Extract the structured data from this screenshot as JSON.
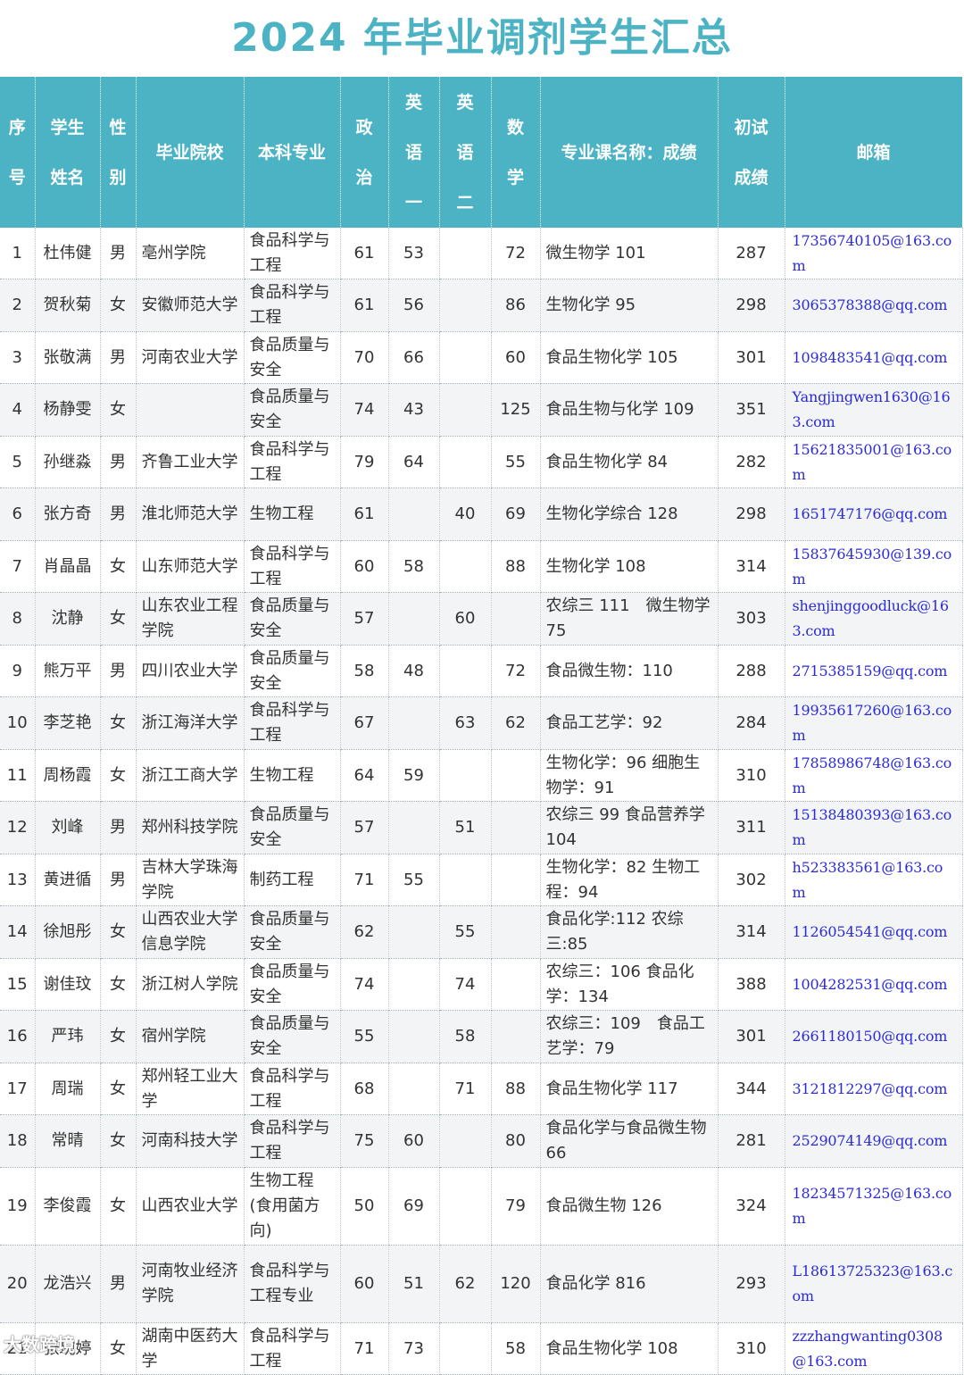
{
  "title": "2024 年毕业调剂学生汇总",
  "headers": [
    "序\n号",
    "学生\n姓名",
    "性\n别",
    "毕业院校",
    "本科专业",
    "政\n治",
    "英\n语\n一",
    "英\n语\n二",
    "数\n学",
    "专业课名称：成绩",
    "初试\n成绩",
    "邮箱"
  ],
  "rows": [
    {
      "no": "1",
      "name": "杜伟健",
      "sex": "男",
      "school": "亳州学院",
      "major": "食品科学与工程",
      "pol": "61",
      "eng1": "53",
      "eng2": "",
      "math": "72",
      "course": "微生物学 101",
      "total": "287",
      "email": "17356740105@163.com"
    },
    {
      "no": "2",
      "name": "贺秋菊",
      "sex": "女",
      "school": "安徽师范大学",
      "major": "食品科学与工程",
      "pol": "61",
      "eng1": "56",
      "eng2": "",
      "math": "86",
      "course": "生物化学 95",
      "total": "298",
      "email": "3065378388@qq.com"
    },
    {
      "no": "3",
      "name": "张敬满",
      "sex": "男",
      "school": "河南农业大学",
      "major": "食品质量与安全",
      "pol": "70",
      "eng1": "66",
      "eng2": "",
      "math": "60",
      "course": "食品生物化学 105",
      "total": "301",
      "email": "1098483541@qq.com"
    },
    {
      "no": "4",
      "name": "杨静雯",
      "sex": "女",
      "school": "",
      "major": "食品质量与安全",
      "pol": "74",
      "eng1": "43",
      "eng2": "",
      "math": "125",
      "course": "食品生物与化学 109",
      "total": "351",
      "email": "Yangjingwen1630@163.com"
    },
    {
      "no": "5",
      "name": "孙继淼",
      "sex": "男",
      "school": "齐鲁工业大学",
      "major": "食品科学与工程",
      "pol": "79",
      "eng1": "64",
      "eng2": "",
      "math": "55",
      "course": "食品生物化学 84",
      "total": "282",
      "email": "15621835001@163.com"
    },
    {
      "no": "6",
      "name": "张方奇",
      "sex": "男",
      "school": "淮北师范大学",
      "major": "生物工程",
      "pol": "61",
      "eng1": "",
      "eng2": "40",
      "math": "69",
      "course": "生物化学综合 128",
      "total": "298",
      "email": "1651747176@qq.com"
    },
    {
      "no": "7",
      "name": "肖晶晶",
      "sex": "女",
      "school": "山东师范大学",
      "major": "食品科学与工程",
      "pol": "60",
      "eng1": "58",
      "eng2": "",
      "math": "88",
      "course": "生物化学 108",
      "total": "314",
      "email": "15837645930@139.com"
    },
    {
      "no": "8",
      "name": "沈静",
      "sex": "女",
      "school": "山东农业工程学院",
      "major": "食品质量与安全",
      "pol": "57",
      "eng1": "",
      "eng2": "60",
      "math": "",
      "course": "农综三 111　微生物学 75",
      "total": "303",
      "email": "shenjinggoodluck@163.com"
    },
    {
      "no": "9",
      "name": "熊万平",
      "sex": "男",
      "school": "四川农业大学",
      "major": "食品质量与安全",
      "pol": "58",
      "eng1": "48",
      "eng2": "",
      "math": "72",
      "course": "食品微生物：110",
      "total": "288",
      "email": "2715385159@qq.com"
    },
    {
      "no": "10",
      "name": "李芝艳",
      "sex": "女",
      "school": "浙江海洋大学",
      "major": "食品科学与工程",
      "pol": "67",
      "eng1": "",
      "eng2": "63",
      "math": "62",
      "course": "食品工艺学：92",
      "total": "284",
      "email": "19935617260@163.com"
    },
    {
      "no": "11",
      "name": "周杨霞",
      "sex": "女",
      "school": "浙江工商大学",
      "major": "生物工程",
      "pol": "64",
      "eng1": "59",
      "eng2": "",
      "math": "",
      "course": "生物化学：96 细胞生物学：91",
      "total": "310",
      "email": "17858986748@163.com"
    },
    {
      "no": "12",
      "name": "刘峰",
      "sex": "男",
      "school": "郑州科技学院",
      "major": "食品质量与安全",
      "pol": "57",
      "eng1": "",
      "eng2": "51",
      "math": "",
      "course": "农综三 99 食品营养学 104",
      "total": "311",
      "email": "15138480393@163.com"
    },
    {
      "no": "13",
      "name": "黄进循",
      "sex": "男",
      "school": "吉林大学珠海学院",
      "major": "制药工程",
      "pol": "71",
      "eng1": "55",
      "eng2": "",
      "math": "",
      "course": "生物化学：82 生物工程：94",
      "total": "302",
      "email": "h523383561@163.com"
    },
    {
      "no": "14",
      "name": "徐旭彤",
      "sex": "女",
      "school": "山西农业大学信息学院",
      "major": "食品质量与安全",
      "pol": "62",
      "eng1": "",
      "eng2": "55",
      "math": "",
      "course": "食品化学:112 农综三:85",
      "total": "314",
      "email": "1126054541@qq.com"
    },
    {
      "no": "15",
      "name": "谢佳玟",
      "sex": "女",
      "school": "浙江树人学院",
      "major": "食品质量与安全",
      "pol": "74",
      "eng1": "",
      "eng2": "74",
      "math": "",
      "course": "农综三：106 食品化学：134",
      "total": "388",
      "email": "1004282531@qq.com"
    },
    {
      "no": "16",
      "name": "严玮",
      "sex": "女",
      "school": "宿州学院",
      "major": "食品质量与安全",
      "pol": "55",
      "eng1": "",
      "eng2": "58",
      "math": "",
      "course": "农综三：109　食品工艺学：79",
      "total": "301",
      "email": "2661180150@qq.com"
    },
    {
      "no": "17",
      "name": "周瑞",
      "sex": "女",
      "school": "郑州轻工业大学",
      "major": "食品科学与工程",
      "pol": "68",
      "eng1": "",
      "eng2": "71",
      "math": "88",
      "course": "食品生物化学 117",
      "total": "344",
      "email": "3121812297@qq.com"
    },
    {
      "no": "18",
      "name": "常晴",
      "sex": "女",
      "school": "河南科技大学",
      "major": "食品科学与工程",
      "pol": "75",
      "eng1": "60",
      "eng2": "",
      "math": "80",
      "course": "食品化学与食品微生物 66",
      "total": "281",
      "email": "2529074149@qq.com"
    },
    {
      "no": "19",
      "name": "李俊霞",
      "sex": "女",
      "school": "山西农业大学",
      "major": "生物工程(食用菌方向)",
      "pol": "50",
      "eng1": "69",
      "eng2": "",
      "math": "79",
      "course": "食品微生物 126",
      "total": "324",
      "email": "18234571325@163.com"
    },
    {
      "no": "20",
      "name": "龙浩兴",
      "sex": "男",
      "school": "河南牧业经济学院",
      "major": "食品科学与工程专业",
      "pol": "60",
      "eng1": "51",
      "eng2": "62",
      "math": "120",
      "course": "食品化学 816",
      "total": "293",
      "email": "L18613725323@163.com"
    },
    {
      "no": "21",
      "name": "张琬婷",
      "sex": "女",
      "school": "湖南中医药大学",
      "major": "食品科学与工程",
      "pol": "71",
      "eng1": "73",
      "eng2": "",
      "math": "58",
      "course": "食品生物化学 108",
      "total": "310",
      "email": "zzzhangwanting0308@163.com"
    }
  ],
  "watermark": "大数跨境"
}
